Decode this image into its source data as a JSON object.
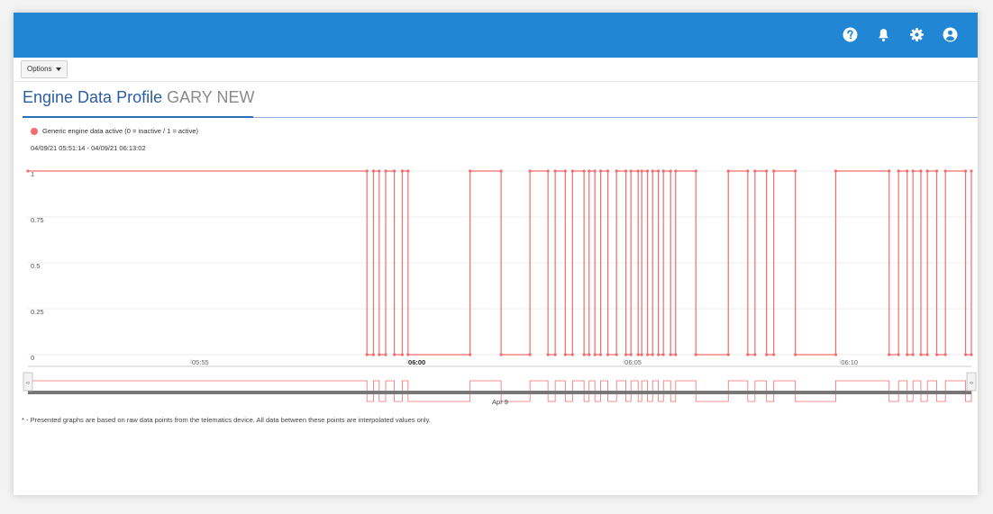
{
  "header": {
    "icons": [
      "help-circle-icon",
      "bell-icon",
      "gear-icon",
      "user-circle-icon"
    ],
    "bar_color": "#2186d4"
  },
  "options": {
    "label": "Options"
  },
  "page": {
    "title": "Engine Data Profile",
    "subtitle": "GARY NEW"
  },
  "legend": {
    "label": "Generic engine data active (0 = inactive / 1 = active)",
    "color": "#f26d6d"
  },
  "range_text": "04/09/21 05:51:14 - 04/09/21 06:13:02",
  "footnote": "* - Presented graphs are based on raw data points from the telematics device. All data between these points are interpolated values only.",
  "chart_data": {
    "type": "line",
    "step": "after",
    "series": [
      {
        "name": "Generic engine data active (0 = inactive / 1 = active)",
        "color": "#f26d6d",
        "transitions": [
          [
            "05:51:14",
            1
          ],
          [
            "05:59:04",
            0
          ],
          [
            "05:59:13",
            1
          ],
          [
            "05:59:21",
            0
          ],
          [
            "05:59:30",
            1
          ],
          [
            "05:59:42",
            0
          ],
          [
            "05:59:53",
            1
          ],
          [
            "06:00:01",
            0
          ],
          [
            "06:01:27",
            1
          ],
          [
            "06:02:10",
            0
          ],
          [
            "06:02:50",
            1
          ],
          [
            "06:03:15",
            0
          ],
          [
            "06:03:25",
            1
          ],
          [
            "06:03:39",
            0
          ],
          [
            "06:03:49",
            1
          ],
          [
            "06:04:05",
            0
          ],
          [
            "06:04:12",
            1
          ],
          [
            "06:04:20",
            0
          ],
          [
            "06:04:28",
            1
          ],
          [
            "06:04:38",
            0
          ],
          [
            "06:04:50",
            1
          ],
          [
            "06:05:03",
            0
          ],
          [
            "06:05:10",
            1
          ],
          [
            "06:05:20",
            0
          ],
          [
            "06:05:25",
            1
          ],
          [
            "06:05:33",
            0
          ],
          [
            "06:05:40",
            1
          ],
          [
            "06:05:48",
            0
          ],
          [
            "06:05:55",
            1
          ],
          [
            "06:06:05",
            0
          ],
          [
            "06:06:12",
            1
          ],
          [
            "06:06:40",
            0
          ],
          [
            "06:07:25",
            1
          ],
          [
            "06:07:52",
            0
          ],
          [
            "06:08:02",
            1
          ],
          [
            "06:08:18",
            0
          ],
          [
            "06:08:28",
            1
          ],
          [
            "06:08:58",
            0
          ],
          [
            "06:09:54",
            1
          ],
          [
            "06:11:08",
            0
          ],
          [
            "06:11:21",
            1
          ],
          [
            "06:11:33",
            0
          ],
          [
            "06:11:41",
            1
          ],
          [
            "06:11:52",
            0
          ],
          [
            "06:12:01",
            1
          ],
          [
            "06:12:14",
            0
          ],
          [
            "06:12:26",
            1
          ],
          [
            "06:12:54",
            0
          ],
          [
            "06:13:02",
            1
          ]
        ]
      }
    ],
    "x_range": [
      "05:51:14",
      "06:13:02"
    ],
    "x_ticks": [
      "05:55",
      "06:00",
      "06:05",
      "06:10"
    ],
    "x_ticks_bold": [
      "06:00"
    ],
    "y_ticks": [
      "0",
      "0.25",
      "0.5",
      "0.75",
      "1"
    ],
    "ylim": [
      0,
      1
    ],
    "navigator_label": "Apr 9",
    "grid": true
  }
}
